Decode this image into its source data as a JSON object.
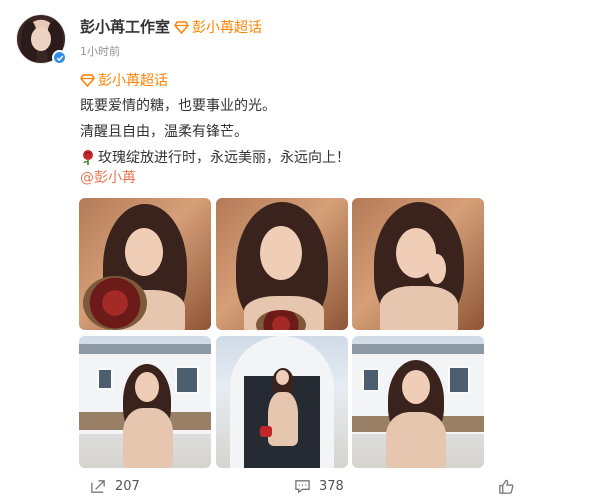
{
  "post": {
    "author": "彭小苒工作室",
    "supertopic_header": "彭小苒超话",
    "time": "1小时前",
    "supertopic_tag": "彭小苒超话",
    "lines": [
      "既要爱情的糖，也要事业的光。",
      "清醒且自由，温柔有锋芒。",
      "玫瑰绽放进行时，永远美丽，永远向上！"
    ],
    "mention": "@彭小苒"
  },
  "photos": [
    {
      "scene": "warm-studio-roses"
    },
    {
      "scene": "warm-studio-closeup"
    },
    {
      "scene": "warm-studio-hand"
    },
    {
      "scene": "outdoor-house"
    },
    {
      "scene": "outdoor-archway"
    },
    {
      "scene": "outdoor-house-closeup"
    }
  ],
  "actions": {
    "repost_count": "207",
    "comment_count": "378"
  },
  "colors": {
    "accent": "#ff8200",
    "mention": "#eb7350",
    "verified": "#2f8fe6"
  }
}
